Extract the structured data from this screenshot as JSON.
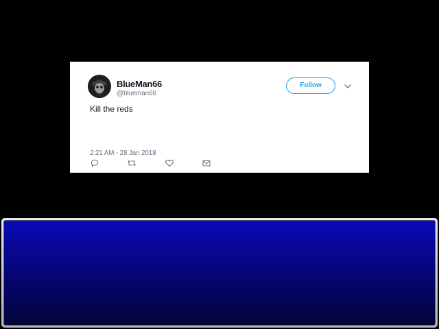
{
  "tweet": {
    "display_name": "BlueMan66",
    "handle": "@blueman66",
    "follow_label": "Follow",
    "text": "Kill the reds",
    "timestamp": "2:21 AM - 28 Jan 2018",
    "icons": {
      "avatar": "pirate-skull-avatar",
      "caret": "chevron-down-icon",
      "reply": "reply-icon",
      "retweet": "retweet-icon",
      "like": "heart-icon",
      "message": "envelope-icon"
    },
    "colors": {
      "accent": "#1da1f2",
      "text": "#14171a",
      "muted": "#657786"
    }
  },
  "message_window": {
    "text": "",
    "colors": {
      "top": "#0a0ab8",
      "bottom": "#03033a",
      "frame": "#c8c8c8"
    }
  }
}
